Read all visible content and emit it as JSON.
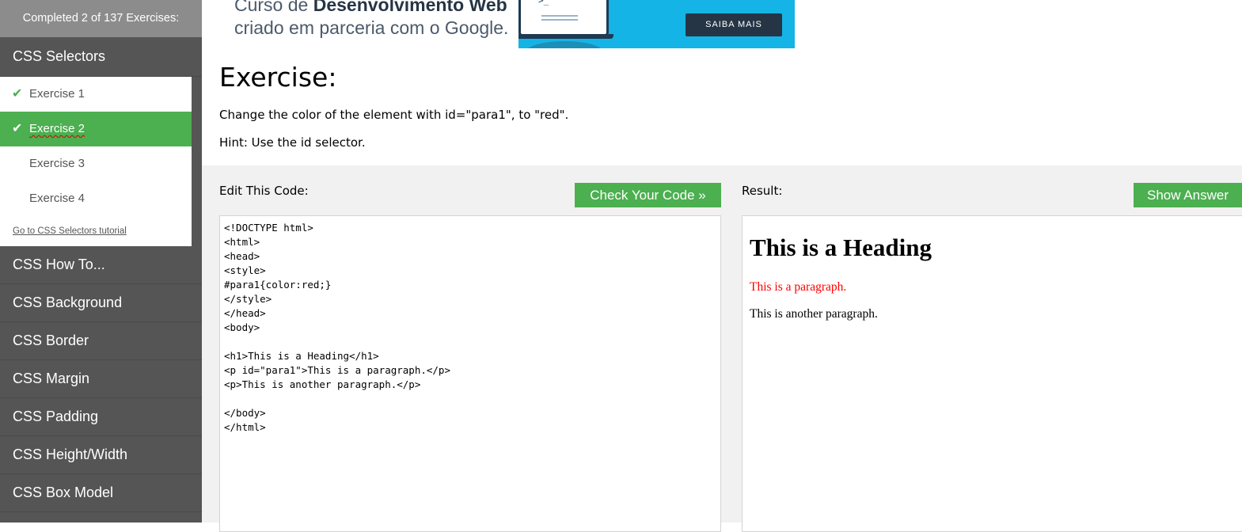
{
  "sidebar": {
    "progress": "Completed 2 of 137 Exercises:",
    "section_title": "CSS Selectors",
    "exercises": [
      {
        "label": "Exercise 1",
        "done": true
      },
      {
        "label": "Exercise 2",
        "done": true,
        "active": true
      },
      {
        "label": "Exercise 3",
        "done": false
      },
      {
        "label": "Exercise 4",
        "done": false
      }
    ],
    "tutorial_link": "Go to CSS Selectors tutorial",
    "sections": [
      "CSS How To...",
      "CSS Background",
      "CSS Border",
      "CSS Margin",
      "CSS Padding",
      "CSS Height/Width",
      "CSS Box Model"
    ]
  },
  "banner": {
    "line1_prefix": "Curso de ",
    "line1_bold": "Desenvolvimento Web",
    "line2": "criado em parceria com o Google.",
    "prompt": ">_",
    "cta": "SAIBA MAIS"
  },
  "exercise": {
    "title": "Exercise:",
    "instruction": "Change the color of the element with id=\"para1\", to \"red\".",
    "hint": "Hint: Use the id selector."
  },
  "editor": {
    "label": "Edit This Code:",
    "check_button": "Check Your Code »",
    "code": "<!DOCTYPE html>\n<html>\n<head>\n<style>\n#para1{color:red;}\n</style>\n</head>\n<body>\n\n<h1>This is a Heading</h1>\n<p id=\"para1\">This is a paragraph.</p>\n<p>This is another paragraph.</p>\n\n</body>\n</html>"
  },
  "result": {
    "label": "Result:",
    "show_answer_button": "Show Answer",
    "heading": "This is a Heading",
    "para1": "This is a paragraph.",
    "para2": "This is another paragraph."
  },
  "colors": {
    "accent_green": "#4caf50",
    "sidebar_bg": "#555555",
    "banner_blue": "#14b4e6",
    "result_red": "#ff0000"
  }
}
